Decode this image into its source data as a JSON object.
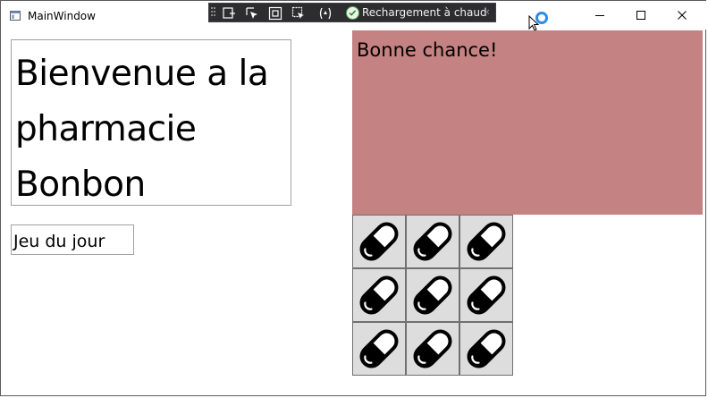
{
  "window": {
    "title": "MainWindow"
  },
  "toolbar": {
    "hot_reload_label": "Rechargement à chaud"
  },
  "main": {
    "welcome_text": "Bienvenue a la pharmacie Bonbon",
    "game_button_label": "Jeu du jour",
    "message_text": "Bonne chance!",
    "message_color": "#c48282",
    "grid": {
      "rows": 3,
      "cols": 3,
      "cell_icon": "pill-icon",
      "cell_background": "#dddddd"
    }
  }
}
